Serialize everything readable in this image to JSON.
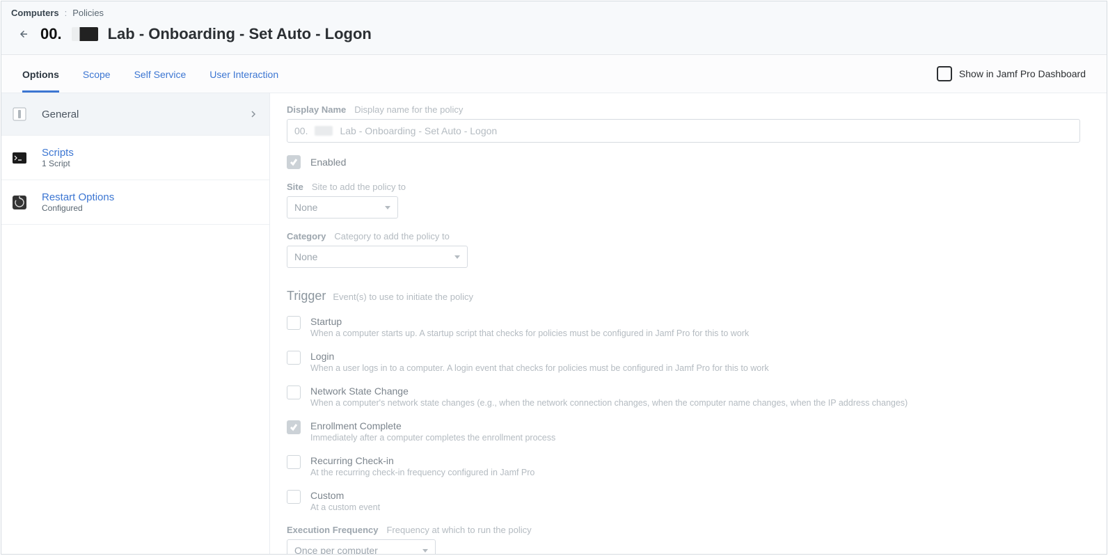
{
  "breadcrumb": {
    "root": "Computers",
    "current": "Policies"
  },
  "header": {
    "title_prefix": "00.",
    "page_title": "Lab - Onboarding - Set Auto - Logon"
  },
  "tabs": {
    "items": [
      {
        "label": "Options",
        "active": true
      },
      {
        "label": "Scope",
        "active": false
      },
      {
        "label": "Self Service",
        "active": false
      },
      {
        "label": "User Interaction",
        "active": false
      }
    ],
    "dashboard_label": "Show in Jamf Pro Dashboard"
  },
  "sidebar": {
    "general": {
      "label": "General"
    },
    "scripts": {
      "label": "Scripts",
      "sub": "1 Script"
    },
    "restart": {
      "label": "Restart Options",
      "sub": "Configured"
    }
  },
  "form": {
    "display_name": {
      "label": "Display Name",
      "hint": "Display name for the policy",
      "prefix": "00.",
      "value": "Lab - Onboarding - Set Auto - Logon"
    },
    "enabled": {
      "label": "Enabled",
      "checked": true
    },
    "site": {
      "label": "Site",
      "hint": "Site to add the policy to",
      "value": "None"
    },
    "category": {
      "label": "Category",
      "hint": "Category to add the policy to",
      "value": "None"
    },
    "trigger": {
      "title": "Trigger",
      "hint": "Event(s) to use to initiate the policy",
      "items": [
        {
          "label": "Startup",
          "desc": "When a computer starts up. A startup script that checks for policies must be configured in Jamf Pro for this to work",
          "checked": false
        },
        {
          "label": "Login",
          "desc": "When a user logs in to a computer. A login event that checks for policies must be configured in Jamf Pro for this to work",
          "checked": false
        },
        {
          "label": "Network State Change",
          "desc": "When a computer's network state changes (e.g., when the network connection changes, when the computer name changes, when the IP address changes)",
          "checked": false
        },
        {
          "label": "Enrollment Complete",
          "desc": "Immediately after a computer completes the enrollment process",
          "checked": true
        },
        {
          "label": "Recurring Check-in",
          "desc": "At the recurring check-in frequency configured in Jamf Pro",
          "checked": false
        },
        {
          "label": "Custom",
          "desc": "At a custom event",
          "checked": false
        }
      ]
    },
    "execution_frequency": {
      "label": "Execution Frequency",
      "hint": "Frequency at which to run the policy",
      "value": "Once per computer"
    }
  }
}
